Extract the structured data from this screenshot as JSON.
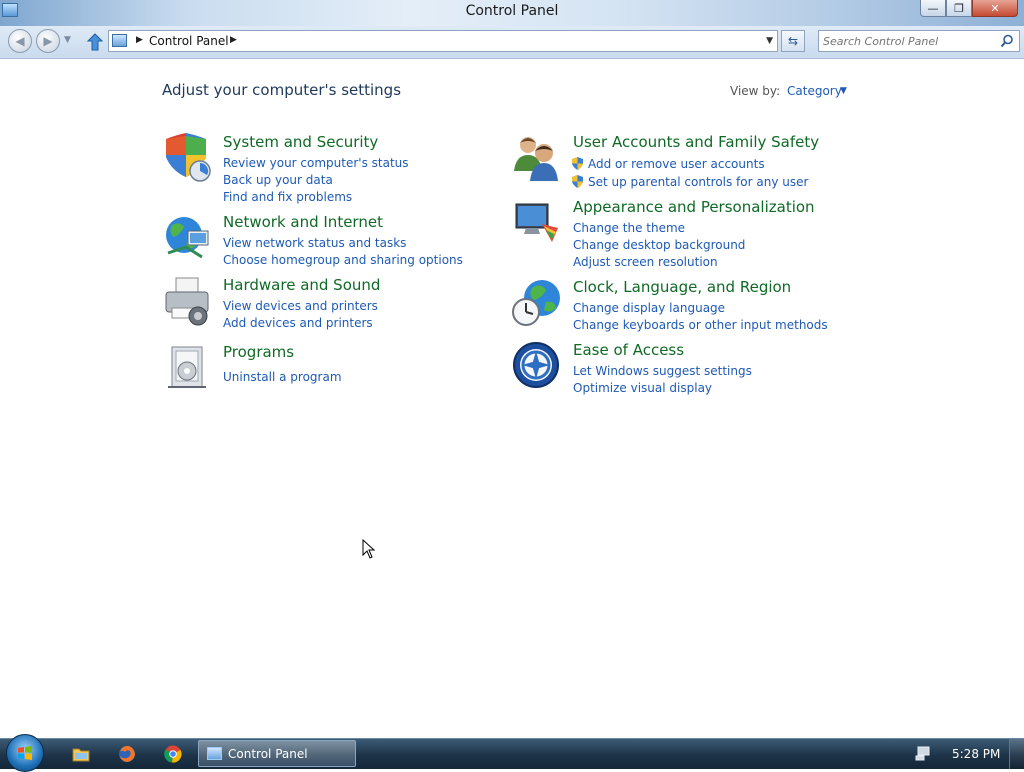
{
  "window": {
    "title": "Control Panel",
    "buttons": {
      "minimize": "—",
      "maximize": "❐",
      "close": "✕"
    }
  },
  "address": {
    "breadcrumb": "Control Panel",
    "search_placeholder": "Search Control Panel"
  },
  "content": {
    "heading": "Adjust your computer's settings",
    "view_by_label": "View by:",
    "view_by_value": "Category"
  },
  "categories": [
    {
      "icon": "shield-icon",
      "title": "System and Security",
      "links": [
        "Review your computer's status",
        "Back up your data",
        "Find and fix problems"
      ]
    },
    {
      "icon": "network-globe-icon",
      "title": "Network and Internet",
      "links": [
        "View network status and tasks",
        "Choose homegroup and sharing options"
      ]
    },
    {
      "icon": "printer-icon",
      "title": "Hardware and Sound",
      "links": [
        "View devices and printers",
        "Add devices and printers"
      ]
    },
    {
      "icon": "programs-icon",
      "title": "Programs",
      "links": [
        "Uninstall a program"
      ]
    },
    {
      "icon": "users-icon",
      "title": "User Accounts and Family Safety",
      "links": [
        "Add or remove user accounts",
        "Set up parental controls for any user"
      ]
    },
    {
      "icon": "appearance-icon",
      "title": "Appearance and Personalization",
      "links": [
        "Change the theme",
        "Change desktop background",
        "Adjust screen resolution"
      ]
    },
    {
      "icon": "clock-globe-icon",
      "title": "Clock, Language, and Region",
      "links": [
        "Change display language",
        "Change keyboards or other input methods"
      ]
    },
    {
      "icon": "ease-of-access-icon",
      "title": "Ease of Access",
      "links": [
        "Let Windows suggest settings",
        "Optimize visual display"
      ]
    }
  ],
  "taskbar": {
    "active_window_label": "Control Panel",
    "clock": "5:28 PM",
    "pinned": [
      "file-explorer-icon",
      "firefox-icon",
      "chrome-icon"
    ]
  },
  "colors": {
    "category_title": "#0f6a25",
    "link": "#1e5ab4",
    "heading": "#1e395b"
  }
}
